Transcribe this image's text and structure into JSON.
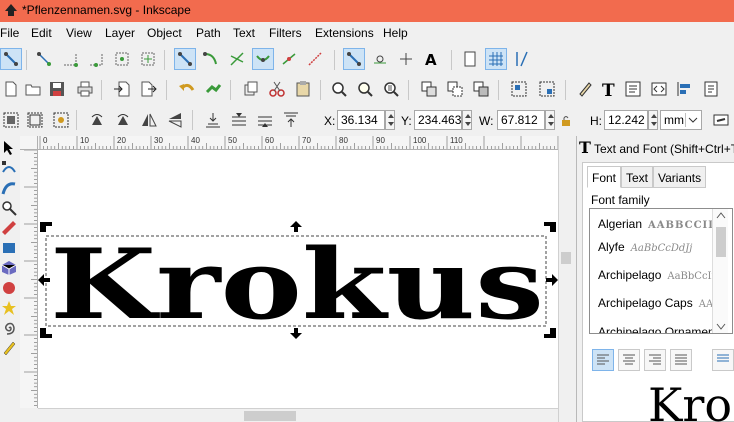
{
  "window": {
    "title": "*Pflenzennamen.svg - Inkscape"
  },
  "menu": [
    "File",
    "Edit",
    "View",
    "Layer",
    "Object",
    "Path",
    "Text",
    "Filters",
    "Extensions",
    "Help"
  ],
  "coords": {
    "x_label": "X:",
    "x_value": "36.134",
    "y_label": "Y:",
    "y_value": "234.463",
    "w_label": "W:",
    "w_value": "67.812",
    "h_label": "H:",
    "h_value": "12.242",
    "unit": "mm"
  },
  "ruler": {
    "labels": [
      "0",
      "10",
      "20",
      "30",
      "40",
      "50",
      "60",
      "70",
      "80",
      "90",
      "100",
      "110"
    ]
  },
  "canvas": {
    "text": "Krokus",
    "text_color": "#000000"
  },
  "dock": {
    "title": "Text and Font (Shift+Ctrl+T)",
    "tabs": [
      "Font",
      "Text",
      "Variants"
    ],
    "font_family_label": "Font family",
    "fonts": [
      {
        "name": "Algerian",
        "preview": "AABBCCIIP"
      },
      {
        "name": "Alyfe",
        "preview": "AaBbCcDdJj"
      },
      {
        "name": "Archipelago",
        "preview": "AaBbCcIi"
      },
      {
        "name": "Archipelago Caps",
        "preview": "AA"
      },
      {
        "name": "Archipelago Ornaments",
        "preview": ""
      }
    ],
    "preview_text": "Kro"
  },
  "colors": {
    "titlebar": "#f26b4e",
    "active_tool": "#cde3f6",
    "accent": "#2a7ccb"
  }
}
